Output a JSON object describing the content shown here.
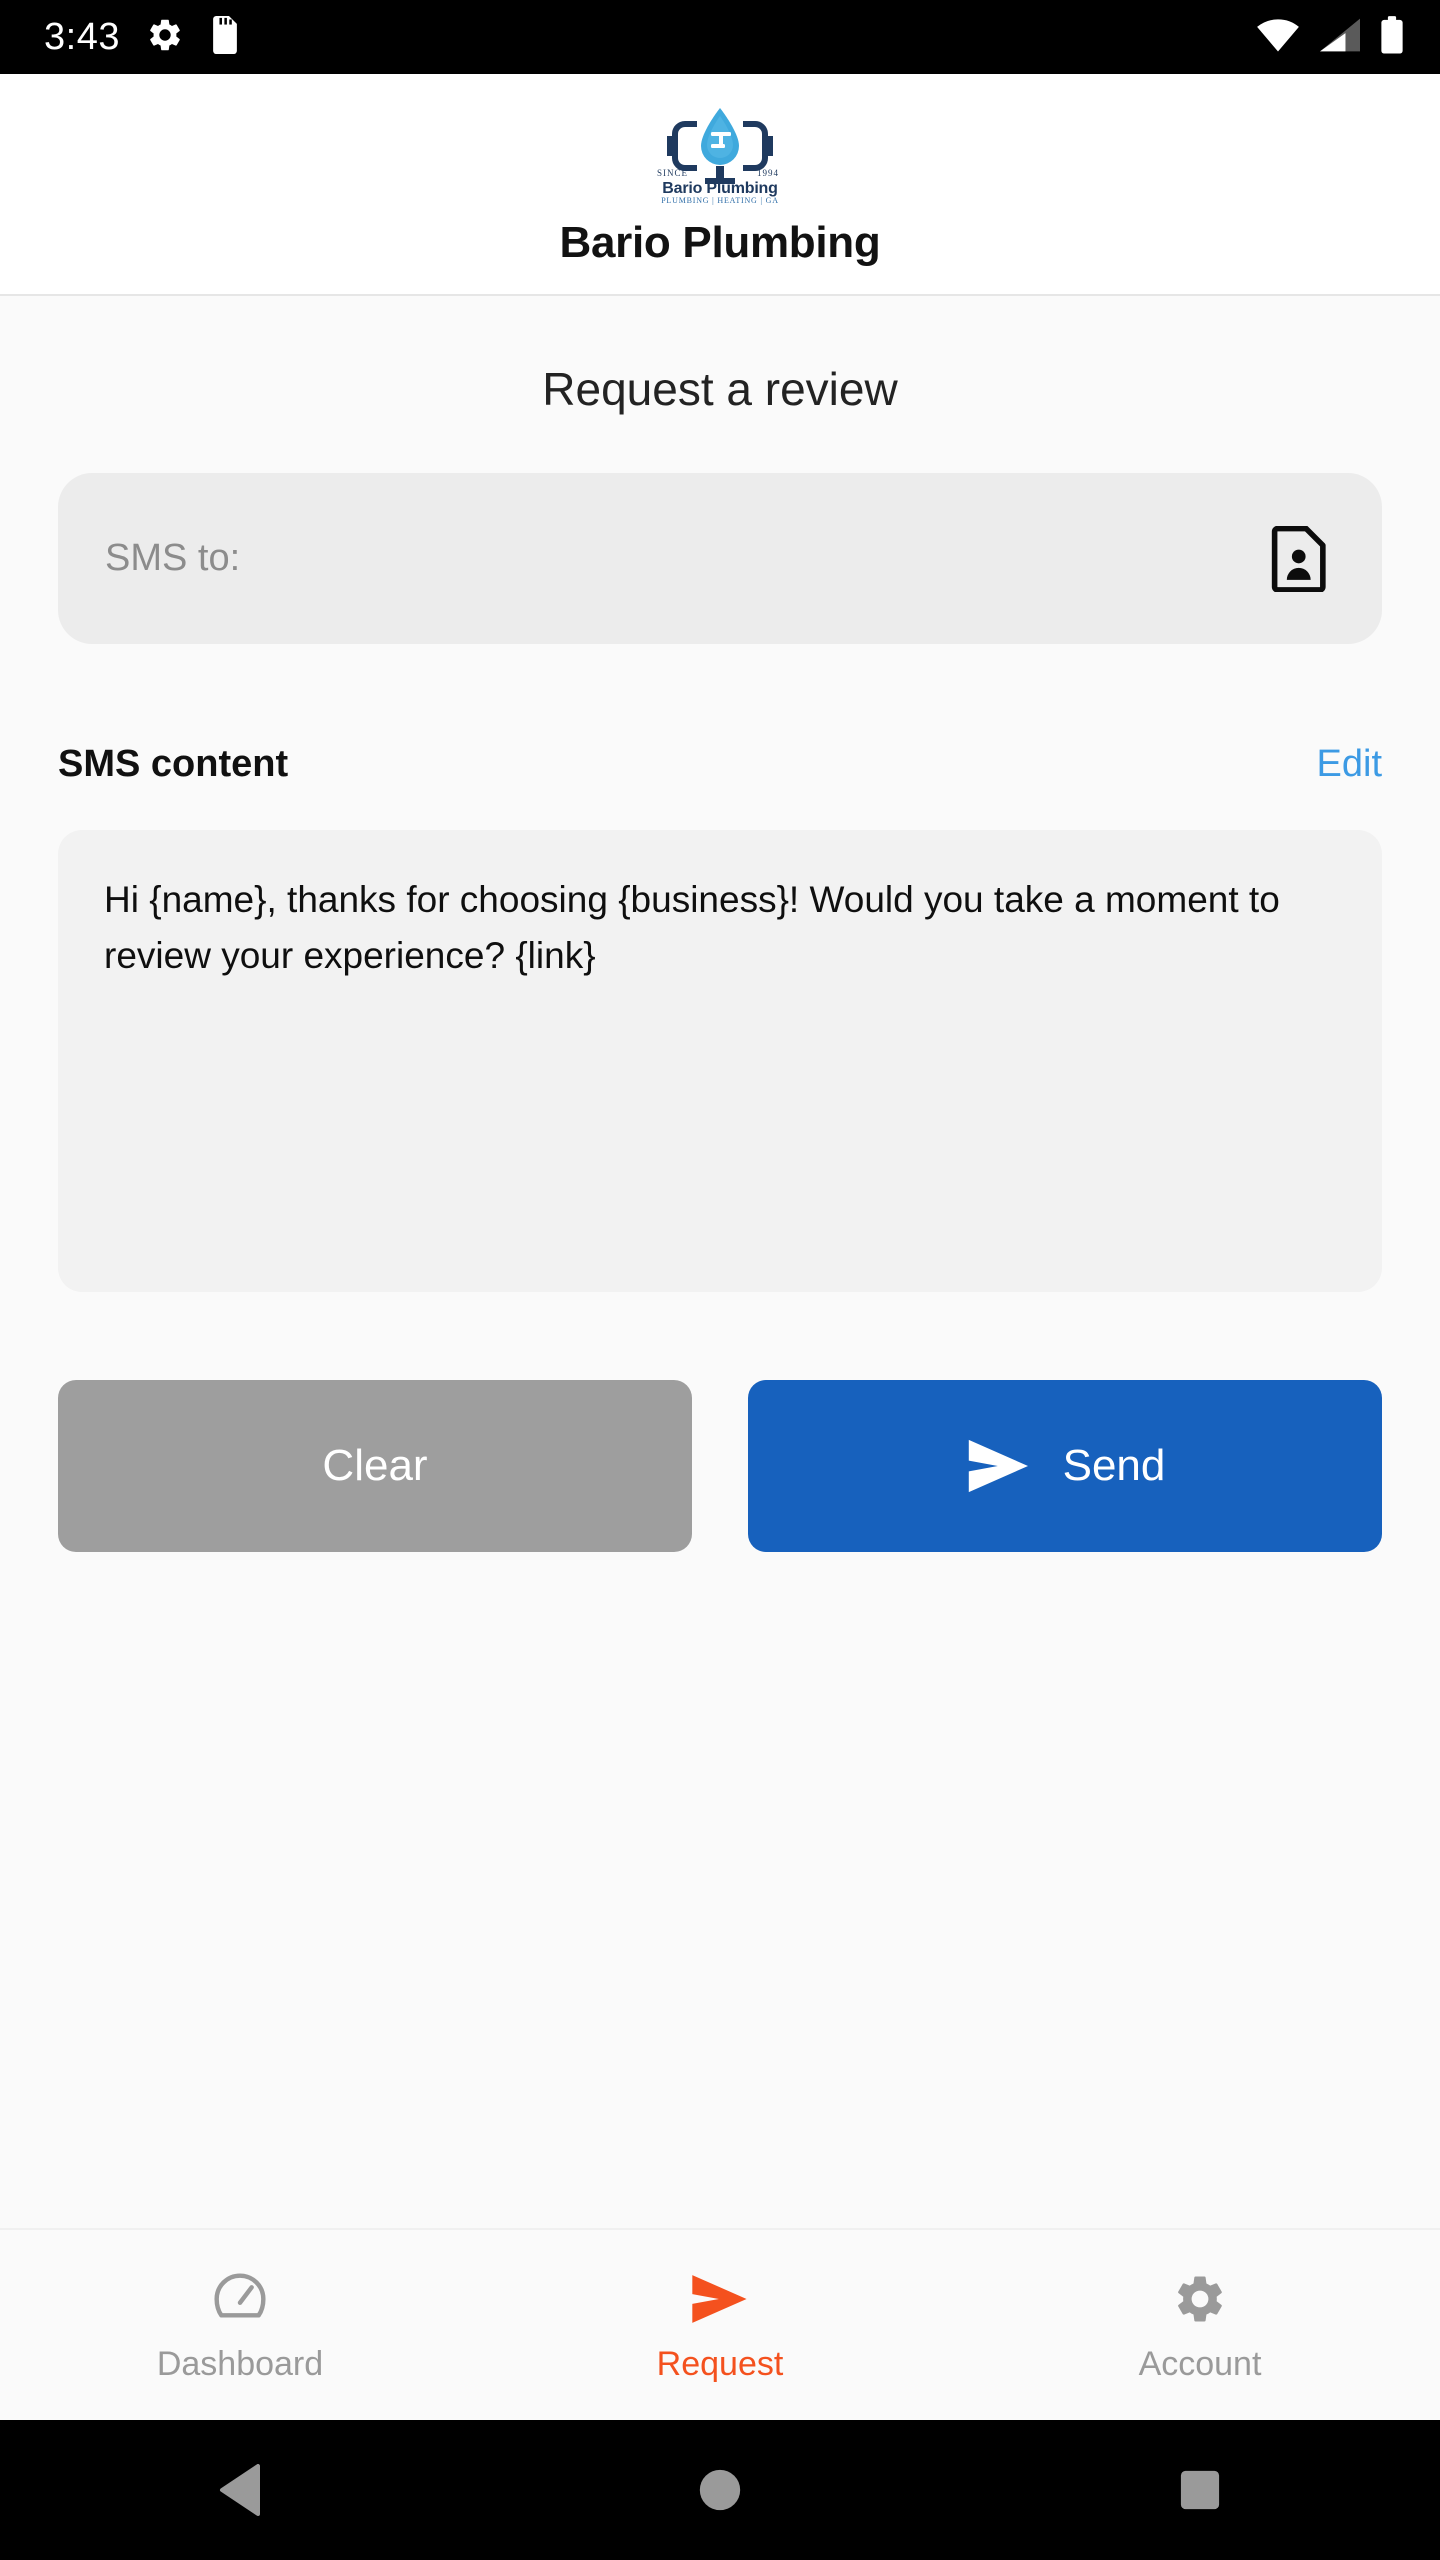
{
  "statusbar": {
    "time": "3:43",
    "icons": [
      "gear-icon",
      "sd-card-icon"
    ],
    "right_icons": [
      "wifi-icon",
      "cellular-signal-icon",
      "battery-icon"
    ]
  },
  "header": {
    "logo": {
      "since_left": "SINCE",
      "since_right": "1994",
      "name": "Bario Plumbing",
      "tagline": "PLUMBING | HEATING | GA"
    },
    "business_name": "Bario Plumbing"
  },
  "main": {
    "page_title": "Request a review",
    "sms_to": {
      "placeholder": "SMS to:",
      "value": "",
      "contact_icon": "contact-card-icon"
    },
    "sms_content": {
      "label": "SMS content",
      "edit_label": "Edit",
      "message": "Hi {name}, thanks for choosing {business}! Would you take a moment to review your experience? {link}"
    },
    "buttons": {
      "clear_label": "Clear",
      "send_label": "Send",
      "send_icon": "send-icon"
    }
  },
  "bottom_nav": {
    "items": [
      {
        "label": "Dashboard",
        "icon": "gauge-icon",
        "active": false
      },
      {
        "label": "Request",
        "icon": "send-icon",
        "active": true
      },
      {
        "label": "Account",
        "icon": "gear-icon",
        "active": false
      }
    ]
  },
  "system_nav": {
    "back": "back-triangle-icon",
    "home": "home-circle-icon",
    "recents": "recents-square-icon"
  },
  "colors": {
    "accent_blue": "#1761bd",
    "link_blue": "#3c9ae4",
    "active_orange": "#f4511e",
    "clear_gray": "#9e9e9e",
    "field_gray": "#ececec",
    "page_bg": "#fafafa"
  }
}
